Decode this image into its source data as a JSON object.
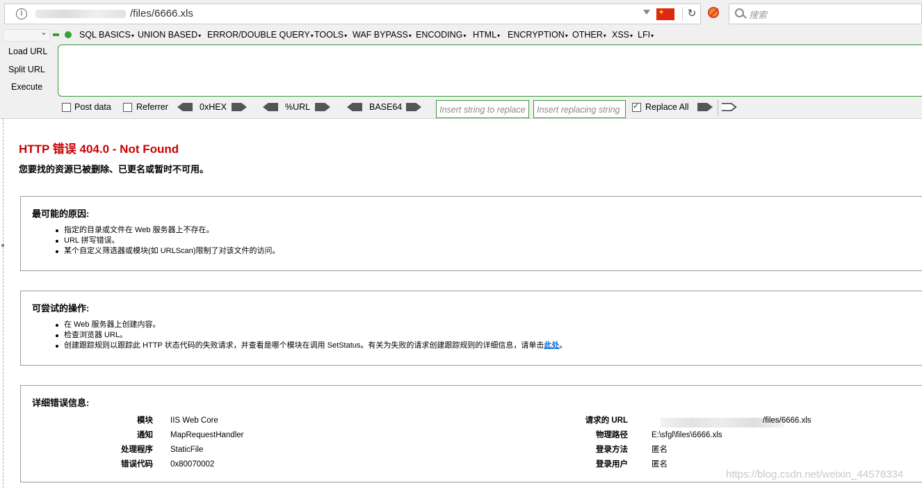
{
  "browser": {
    "url_tail": "/files/6666.xls",
    "search_placeholder": "搜索",
    "flag_label": "★"
  },
  "hackbar": {
    "menus": [
      "SQL BASICS",
      "UNION BASED",
      "ERROR/DOUBLE QUERY",
      "TOOLS",
      "WAF BYPASS",
      "ENCODING",
      "HTML",
      "ENCRYPTION",
      "OTHER",
      "XSS",
      "LFI"
    ],
    "load_url": "Load URL",
    "split_url": "Split URL",
    "execute": "Execute",
    "post_data": "Post data",
    "referrer": "Referrer",
    "hex": "0xHEX",
    "url_enc": "%URL",
    "base64": "BASE64",
    "insert_string_placeholder": "Insert string to replace",
    "insert_replacing_placeholder": "Insert replacing string",
    "replace_all": "Replace All",
    "replace_all_checked": true
  },
  "error": {
    "title": "HTTP 错误 404.0 - Not Found",
    "subtitle": "您要找的资源已被删除、已更名或暂时不可用。",
    "causes_title": "最可能的原因:",
    "causes": [
      "指定的目录或文件在 Web 服务器上不存在。",
      "URL 拼写错误。",
      "某个自定义筛选器或模块(如 URLScan)限制了对该文件的访问。"
    ],
    "actions_title": "可尝试的操作:",
    "actions": [
      "在 Web 服务器上创建内容。",
      "检查浏览器 URL。"
    ],
    "action_last_prefix": "创建跟踪规则以跟踪此 HTTP 状态代码的失败请求，并查看是哪个模块在调用 SetStatus。有关为失败的请求创建跟踪规则的详细信息，请单击",
    "action_last_link": "此处",
    "action_last_suffix": "。",
    "details_title": "详细错误信息:",
    "details_left": [
      {
        "key": "模块",
        "value": "IIS Web Core"
      },
      {
        "key": "通知",
        "value": "MapRequestHandler"
      },
      {
        "key": "处理程序",
        "value": "StaticFile"
      },
      {
        "key": "错误代码",
        "value": "0x80070002"
      }
    ],
    "details_right": [
      {
        "key": "请求的 URL",
        "value": "/files/6666.xls"
      },
      {
        "key": "物理路径",
        "value": "E:\\sfgl\\files\\6666.xls"
      },
      {
        "key": "登录方法",
        "value": "匿名"
      },
      {
        "key": "登录用户",
        "value": "匿名"
      }
    ]
  },
  "watermark": "https://blog.csdn.net/weixin_44578334"
}
